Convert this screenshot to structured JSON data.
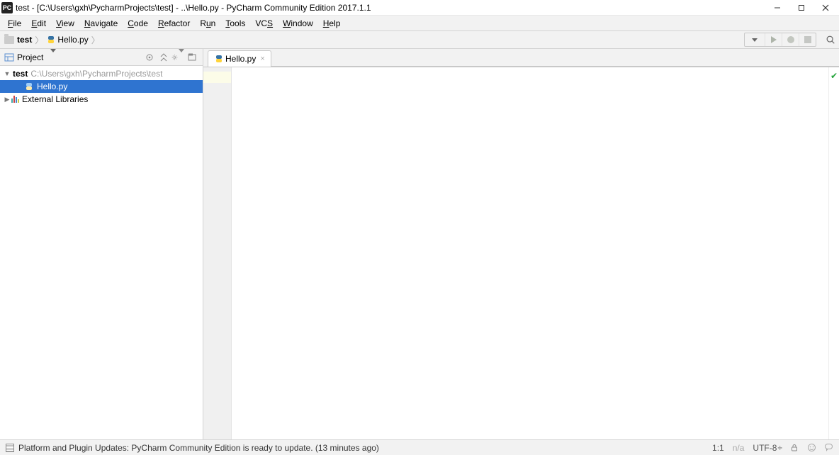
{
  "title": "test - [C:\\Users\\gxh\\PycharmProjects\\test] - ..\\Hello.py - PyCharm Community Edition 2017.1.1",
  "menu": [
    "File",
    "Edit",
    "View",
    "Navigate",
    "Code",
    "Refactor",
    "Run",
    "Tools",
    "VCS",
    "Window",
    "Help"
  ],
  "breadcrumbs": [
    {
      "label": "test",
      "bold": true,
      "icon": "folder"
    },
    {
      "label": "Hello.py",
      "bold": false,
      "icon": "py"
    }
  ],
  "project_panel": {
    "title": "Project",
    "root": {
      "label": "test",
      "path": "C:\\Users\\gxh\\PycharmProjects\\test"
    },
    "children": [
      {
        "label": "Hello.py",
        "selected": true,
        "icon": "py"
      }
    ],
    "external": {
      "label": "External Libraries"
    }
  },
  "editor_tabs": [
    {
      "label": "Hello.py",
      "icon": "py",
      "active": true
    }
  ],
  "status": {
    "message": "Platform and Plugin Updates: PyCharm Community Edition is ready to update. (13 minutes ago)",
    "pos": "1:1",
    "na": "n/a",
    "encoding": "UTF-8",
    "enc_suffix": "÷"
  },
  "colors": {
    "selection": "#2f74d0",
    "check": "#23a33a"
  }
}
